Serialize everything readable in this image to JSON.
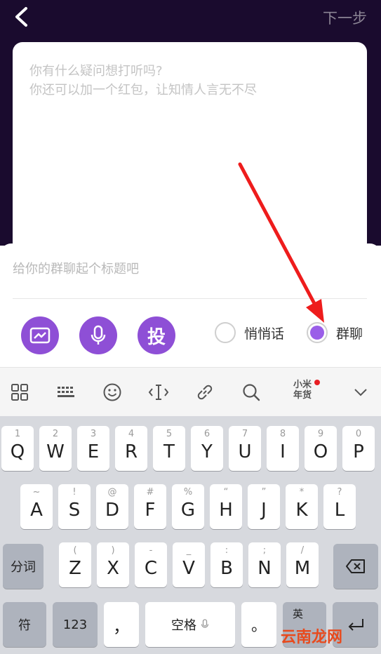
{
  "header": {
    "next_label": "下一步"
  },
  "question": {
    "placeholder_line1": "你有什么疑问想打听吗?",
    "placeholder_line2": "你还可以加一个红包，让知情人言无不尽"
  },
  "panel": {
    "title_placeholder": "给你的群聊起个标题吧",
    "tou_label": "投",
    "radio_whisper": "悄悄话",
    "radio_group": "群聊",
    "selected_option": "群聊",
    "accent_color": "#8e4fd6"
  },
  "toolbar": {
    "badge_line1": "小米",
    "badge_line2": "年货"
  },
  "keyboard": {
    "row1": [
      {
        "hint": "1",
        "key": "Q"
      },
      {
        "hint": "2",
        "key": "W"
      },
      {
        "hint": "3",
        "key": "E"
      },
      {
        "hint": "4",
        "key": "R"
      },
      {
        "hint": "5",
        "key": "T"
      },
      {
        "hint": "6",
        "key": "Y"
      },
      {
        "hint": "7",
        "key": "U"
      },
      {
        "hint": "8",
        "key": "I"
      },
      {
        "hint": "9",
        "key": "O"
      },
      {
        "hint": "0",
        "key": "P"
      }
    ],
    "row2": [
      {
        "hint": "~",
        "key": "A"
      },
      {
        "hint": "!",
        "key": "S"
      },
      {
        "hint": "@",
        "key": "D"
      },
      {
        "hint": "#",
        "key": "F"
      },
      {
        "hint": "%",
        "key": "G"
      },
      {
        "hint": "“",
        "key": "H"
      },
      {
        "hint": "”",
        "key": "J"
      },
      {
        "hint": "*",
        "key": "K"
      },
      {
        "hint": "?",
        "key": "L"
      }
    ],
    "row3": [
      {
        "hint": "(",
        "key": "Z"
      },
      {
        "hint": ")",
        "key": "X"
      },
      {
        "hint": "-",
        "key": "C"
      },
      {
        "hint": "_",
        "key": "V"
      },
      {
        "hint": ":",
        "key": "B"
      },
      {
        "hint": ";",
        "key": "N"
      },
      {
        "hint": "/",
        "key": "M"
      }
    ],
    "fenci": "分词",
    "fu": "符",
    "num": "123",
    "comma": "，",
    "space": "空格",
    "period": "。",
    "lang": "英"
  },
  "watermark": "云南龙网"
}
